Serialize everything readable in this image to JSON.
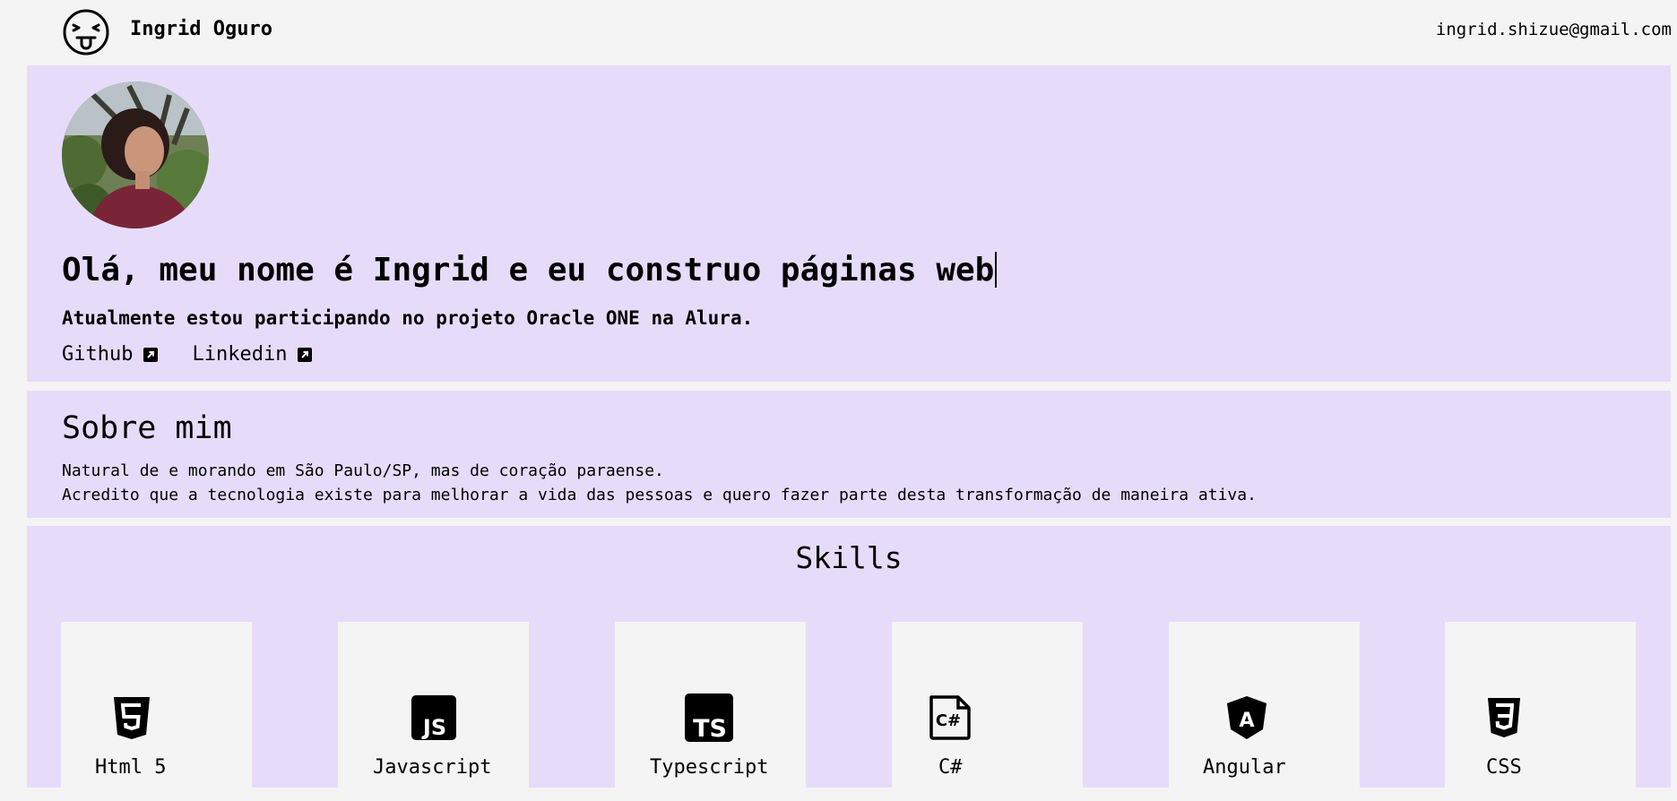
{
  "header": {
    "name": "Ingrid Oguro",
    "email": "ingrid.shizue@gmail.com",
    "logo_icon": "tongue-face-icon"
  },
  "hero": {
    "title": "Olá, meu nome é Ingrid e eu construo páginas web",
    "subtitle": "Atualmente estou participando no projeto Oracle ONE na Alura.",
    "links": [
      {
        "label": "Github",
        "icon": "external-link-icon"
      },
      {
        "label": "Linkedin",
        "icon": "external-link-icon"
      }
    ]
  },
  "about": {
    "title": "Sobre mim",
    "lines": [
      "Natural de e morando em São Paulo/SP, mas de coração paraense.",
      "Acredito que a tecnologia existe para melhorar a vida das pessoas e quero fazer parte desta transformação de maneira ativa."
    ]
  },
  "skills": {
    "title": "Skills",
    "items": [
      {
        "label": "Html 5",
        "icon": "html5-icon"
      },
      {
        "label": "Javascript",
        "icon": "javascript-icon"
      },
      {
        "label": "Typescript",
        "icon": "typescript-icon"
      },
      {
        "label": "C#",
        "icon": "csharp-file-icon"
      },
      {
        "label": "Angular",
        "icon": "angular-icon"
      },
      {
        "label": "CSS",
        "icon": "css3-icon"
      }
    ]
  },
  "colors": {
    "panel": "#e6dcfa",
    "background": "#f4f4f4"
  }
}
